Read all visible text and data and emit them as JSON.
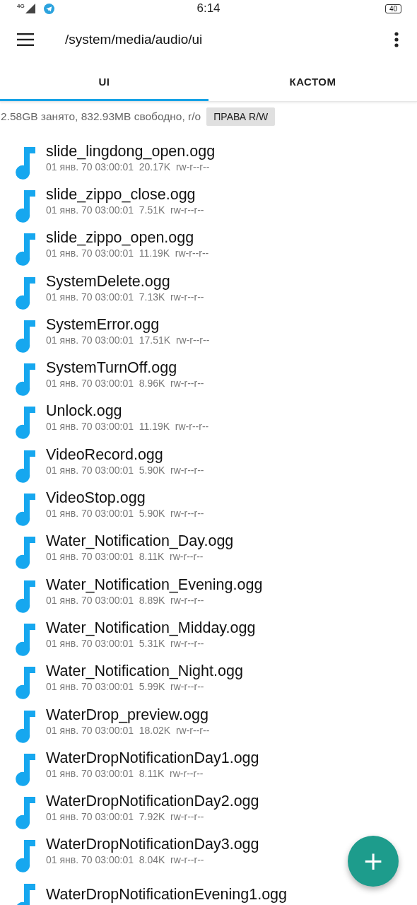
{
  "status_bar": {
    "network": "4G",
    "time": "6:14",
    "battery": "40"
  },
  "toolbar": {
    "path": "/system/media/audio/ui"
  },
  "tabs": [
    {
      "label": "UI",
      "selected": true
    },
    {
      "label": "КАСТОМ",
      "selected": false
    }
  ],
  "storage": {
    "info": "2.58GB занято, 832.93MB свободно, r/o",
    "button": "ПРАВА R/W"
  },
  "files": [
    {
      "name": "slide_lingdong_open.ogg",
      "meta": "01 янв. 70 03:00:01  20.17K  rw-r--r--"
    },
    {
      "name": "slide_zippo_close.ogg",
      "meta": "01 янв. 70 03:00:01  7.51K  rw-r--r--"
    },
    {
      "name": "slide_zippo_open.ogg",
      "meta": "01 янв. 70 03:00:01  11.19K  rw-r--r--"
    },
    {
      "name": "SystemDelete.ogg",
      "meta": "01 янв. 70 03:00:01  7.13K  rw-r--r--"
    },
    {
      "name": "SystemError.ogg",
      "meta": "01 янв. 70 03:00:01  17.51K  rw-r--r--"
    },
    {
      "name": "SystemTurnOff.ogg",
      "meta": "01 янв. 70 03:00:01  8.96K  rw-r--r--"
    },
    {
      "name": "Unlock.ogg",
      "meta": "01 янв. 70 03:00:01  11.19K  rw-r--r--"
    },
    {
      "name": "VideoRecord.ogg",
      "meta": "01 янв. 70 03:00:01  5.90K  rw-r--r--"
    },
    {
      "name": "VideoStop.ogg",
      "meta": "01 янв. 70 03:00:01  5.90K  rw-r--r--"
    },
    {
      "name": "Water_Notification_Day.ogg",
      "meta": "01 янв. 70 03:00:01  8.11K  rw-r--r--"
    },
    {
      "name": "Water_Notification_Evening.ogg",
      "meta": "01 янв. 70 03:00:01  8.89K  rw-r--r--"
    },
    {
      "name": "Water_Notification_Midday.ogg",
      "meta": "01 янв. 70 03:00:01  5.31K  rw-r--r--"
    },
    {
      "name": "Water_Notification_Night.ogg",
      "meta": "01 янв. 70 03:00:01  5.99K  rw-r--r--"
    },
    {
      "name": "WaterDrop_preview.ogg",
      "meta": "01 янв. 70 03:00:01  18.02K  rw-r--r--"
    },
    {
      "name": "WaterDropNotificationDay1.ogg",
      "meta": "01 янв. 70 03:00:01  8.11K  rw-r--r--"
    },
    {
      "name": "WaterDropNotificationDay2.ogg",
      "meta": "01 янв. 70 03:00:01  7.92K  rw-r--r--"
    },
    {
      "name": "WaterDropNotificationDay3.ogg",
      "meta": "01 янв. 70 03:00:01  8.04K  rw-r--r--"
    },
    {
      "name": "WaterDropNotificationEvening1.ogg"
    }
  ],
  "fab": {
    "label": "+"
  }
}
